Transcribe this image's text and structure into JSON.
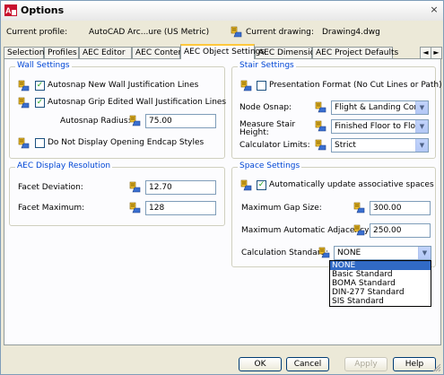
{
  "window": {
    "title": "Options",
    "close_label": "×"
  },
  "header": {
    "profile_label": "Current profile:",
    "profile_value": "AutoCAD Arc...ure (US Metric)",
    "drawing_label": "Current drawing:",
    "drawing_value": "Drawing4.dwg"
  },
  "tabs": [
    {
      "label": "Selection"
    },
    {
      "label": "Profiles"
    },
    {
      "label": "AEC Editor"
    },
    {
      "label": "AEC Content"
    },
    {
      "label": "AEC Object Settings",
      "active": true
    },
    {
      "label": "AEC Dimension"
    },
    {
      "label": "AEC Project Defaults"
    }
  ],
  "tab_scroll": {
    "left": "◄",
    "right": "►"
  },
  "wall_settings": {
    "title": "Wall Settings",
    "autosnap_new": {
      "label": "Autosnap New Wall Justification Lines",
      "checked": true
    },
    "autosnap_grip": {
      "label": "Autosnap Grip Edited Wall Justification Lines",
      "checked": true
    },
    "autosnap_radius": {
      "label": "Autosnap Radius:",
      "value": "75.00"
    },
    "endcap": {
      "label": "Do Not Display Opening Endcap Styles",
      "checked": false
    }
  },
  "stair_settings": {
    "title": "Stair Settings",
    "presentation": {
      "label": "Presentation Format (No Cut Lines or Path)",
      "checked": false
    },
    "node_osnap": {
      "label": "Node Osnap:",
      "value": "Flight & Landing Corners"
    },
    "measure_height": {
      "label": "Measure Stair Height:",
      "value": "Finished Floor to Floor"
    },
    "calc_limits": {
      "label": "Calculator Limits:",
      "value": "Strict"
    }
  },
  "display_resolution": {
    "title": "AEC Display Resolution",
    "facet_deviation": {
      "label": "Facet Deviation:",
      "value": "12.70"
    },
    "facet_maximum": {
      "label": "Facet Maximum:",
      "value": "128"
    }
  },
  "space_settings": {
    "title": "Space Settings",
    "auto_update": {
      "label": "Automatically update associative spaces",
      "checked": true
    },
    "max_gap": {
      "label": "Maximum Gap Size:",
      "value": "300.00"
    },
    "max_adjacency": {
      "label": "Maximum Automatic Adjacency",
      "value": "250.00"
    },
    "calc_standard": {
      "label": "Calculation Standard:",
      "value": "NONE"
    },
    "dropdown_options": [
      "NONE",
      "Basic Standard",
      "BOMA Standard",
      "DIN-277 Standard",
      "SIS Standard"
    ]
  },
  "dropdown_arrow": "▼",
  "footer": {
    "ok": "OK",
    "cancel": "Cancel",
    "apply": "Apply",
    "help": "Help"
  },
  "colors": {
    "group_title": "#0046d5",
    "active_tab_accent": "#ffc83c",
    "selection": "#316ac5"
  }
}
